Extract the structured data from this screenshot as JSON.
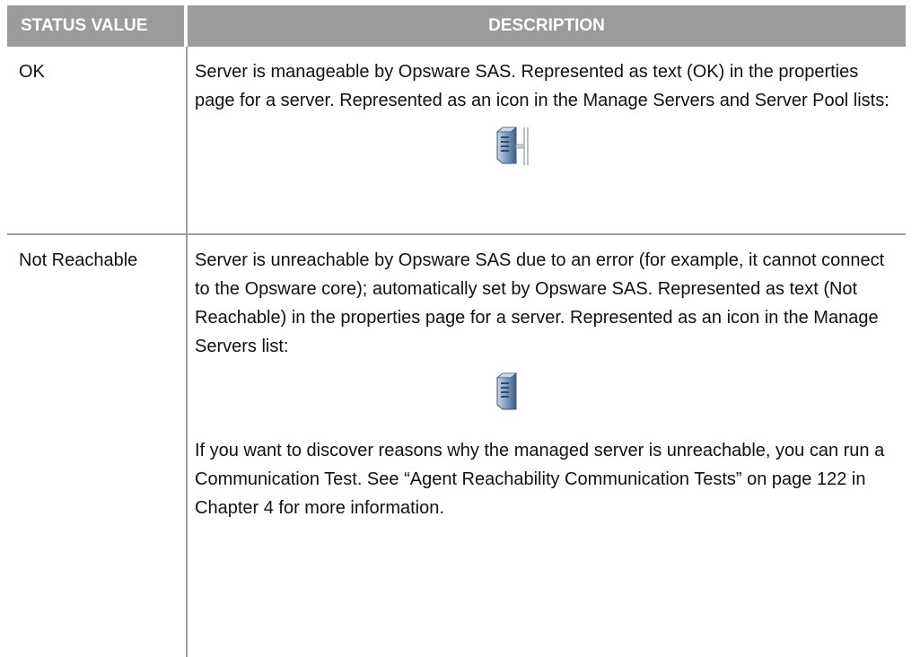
{
  "table": {
    "headers": {
      "status": "STATUS VALUE",
      "description": "DESCRIPTION"
    },
    "rows": [
      {
        "status": "OK",
        "description": "Server is manageable by Opsware SAS. Represented as text (OK) in the properties page for a server. Represented as an icon in the Manage Servers and Server Pool lists:",
        "icon": "server-ok-icon"
      },
      {
        "status": "Not Reachable",
        "description": "Server is unreachable by Opsware SAS due to an error (for example, it cannot connect to the Opsware core); automatically set by Opsware SAS. Represented as text (Not Reachable) in the properties page for a server. Represented as an icon in the Manage Servers list:",
        "icon": "server-unreachable-icon",
        "note": "If you want to discover reasons why the managed server is unreachable, you can run a Communication Test. See “Agent Reachability Communication Tests” on page 122 in Chapter 4 for more information."
      }
    ]
  },
  "colors": {
    "header_bg": "#9b9b9b",
    "header_text": "#ffffff",
    "rule": "#9e9e9e"
  }
}
